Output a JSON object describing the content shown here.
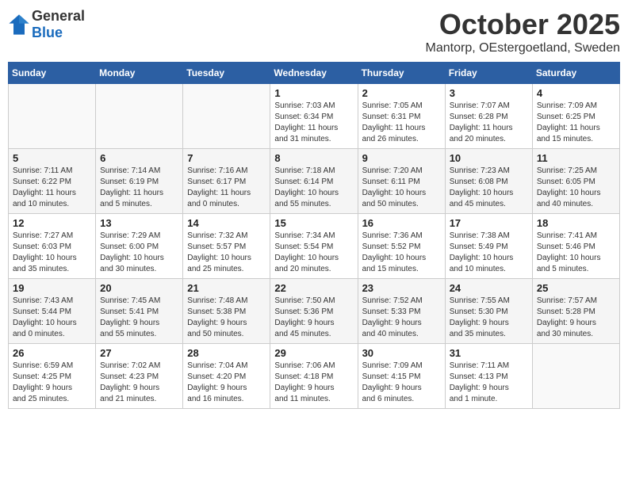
{
  "logo": {
    "general": "General",
    "blue": "Blue"
  },
  "title": "October 2025",
  "location": "Mantorp, OEstergoetland, Sweden",
  "days_of_week": [
    "Sunday",
    "Monday",
    "Tuesday",
    "Wednesday",
    "Thursday",
    "Friday",
    "Saturday"
  ],
  "weeks": [
    [
      {
        "day": "",
        "info": ""
      },
      {
        "day": "",
        "info": ""
      },
      {
        "day": "",
        "info": ""
      },
      {
        "day": "1",
        "info": "Sunrise: 7:03 AM\nSunset: 6:34 PM\nDaylight: 11 hours\nand 31 minutes."
      },
      {
        "day": "2",
        "info": "Sunrise: 7:05 AM\nSunset: 6:31 PM\nDaylight: 11 hours\nand 26 minutes."
      },
      {
        "day": "3",
        "info": "Sunrise: 7:07 AM\nSunset: 6:28 PM\nDaylight: 11 hours\nand 20 minutes."
      },
      {
        "day": "4",
        "info": "Sunrise: 7:09 AM\nSunset: 6:25 PM\nDaylight: 11 hours\nand 15 minutes."
      }
    ],
    [
      {
        "day": "5",
        "info": "Sunrise: 7:11 AM\nSunset: 6:22 PM\nDaylight: 11 hours\nand 10 minutes."
      },
      {
        "day": "6",
        "info": "Sunrise: 7:14 AM\nSunset: 6:19 PM\nDaylight: 11 hours\nand 5 minutes."
      },
      {
        "day": "7",
        "info": "Sunrise: 7:16 AM\nSunset: 6:17 PM\nDaylight: 11 hours\nand 0 minutes."
      },
      {
        "day": "8",
        "info": "Sunrise: 7:18 AM\nSunset: 6:14 PM\nDaylight: 10 hours\nand 55 minutes."
      },
      {
        "day": "9",
        "info": "Sunrise: 7:20 AM\nSunset: 6:11 PM\nDaylight: 10 hours\nand 50 minutes."
      },
      {
        "day": "10",
        "info": "Sunrise: 7:23 AM\nSunset: 6:08 PM\nDaylight: 10 hours\nand 45 minutes."
      },
      {
        "day": "11",
        "info": "Sunrise: 7:25 AM\nSunset: 6:05 PM\nDaylight: 10 hours\nand 40 minutes."
      }
    ],
    [
      {
        "day": "12",
        "info": "Sunrise: 7:27 AM\nSunset: 6:03 PM\nDaylight: 10 hours\nand 35 minutes."
      },
      {
        "day": "13",
        "info": "Sunrise: 7:29 AM\nSunset: 6:00 PM\nDaylight: 10 hours\nand 30 minutes."
      },
      {
        "day": "14",
        "info": "Sunrise: 7:32 AM\nSunset: 5:57 PM\nDaylight: 10 hours\nand 25 minutes."
      },
      {
        "day": "15",
        "info": "Sunrise: 7:34 AM\nSunset: 5:54 PM\nDaylight: 10 hours\nand 20 minutes."
      },
      {
        "day": "16",
        "info": "Sunrise: 7:36 AM\nSunset: 5:52 PM\nDaylight: 10 hours\nand 15 minutes."
      },
      {
        "day": "17",
        "info": "Sunrise: 7:38 AM\nSunset: 5:49 PM\nDaylight: 10 hours\nand 10 minutes."
      },
      {
        "day": "18",
        "info": "Sunrise: 7:41 AM\nSunset: 5:46 PM\nDaylight: 10 hours\nand 5 minutes."
      }
    ],
    [
      {
        "day": "19",
        "info": "Sunrise: 7:43 AM\nSunset: 5:44 PM\nDaylight: 10 hours\nand 0 minutes."
      },
      {
        "day": "20",
        "info": "Sunrise: 7:45 AM\nSunset: 5:41 PM\nDaylight: 9 hours\nand 55 minutes."
      },
      {
        "day": "21",
        "info": "Sunrise: 7:48 AM\nSunset: 5:38 PM\nDaylight: 9 hours\nand 50 minutes."
      },
      {
        "day": "22",
        "info": "Sunrise: 7:50 AM\nSunset: 5:36 PM\nDaylight: 9 hours\nand 45 minutes."
      },
      {
        "day": "23",
        "info": "Sunrise: 7:52 AM\nSunset: 5:33 PM\nDaylight: 9 hours\nand 40 minutes."
      },
      {
        "day": "24",
        "info": "Sunrise: 7:55 AM\nSunset: 5:30 PM\nDaylight: 9 hours\nand 35 minutes."
      },
      {
        "day": "25",
        "info": "Sunrise: 7:57 AM\nSunset: 5:28 PM\nDaylight: 9 hours\nand 30 minutes."
      }
    ],
    [
      {
        "day": "26",
        "info": "Sunrise: 6:59 AM\nSunset: 4:25 PM\nDaylight: 9 hours\nand 25 minutes."
      },
      {
        "day": "27",
        "info": "Sunrise: 7:02 AM\nSunset: 4:23 PM\nDaylight: 9 hours\nand 21 minutes."
      },
      {
        "day": "28",
        "info": "Sunrise: 7:04 AM\nSunset: 4:20 PM\nDaylight: 9 hours\nand 16 minutes."
      },
      {
        "day": "29",
        "info": "Sunrise: 7:06 AM\nSunset: 4:18 PM\nDaylight: 9 hours\nand 11 minutes."
      },
      {
        "day": "30",
        "info": "Sunrise: 7:09 AM\nSunset: 4:15 PM\nDaylight: 9 hours\nand 6 minutes."
      },
      {
        "day": "31",
        "info": "Sunrise: 7:11 AM\nSunset: 4:13 PM\nDaylight: 9 hours\nand 1 minute."
      },
      {
        "day": "",
        "info": ""
      }
    ]
  ]
}
